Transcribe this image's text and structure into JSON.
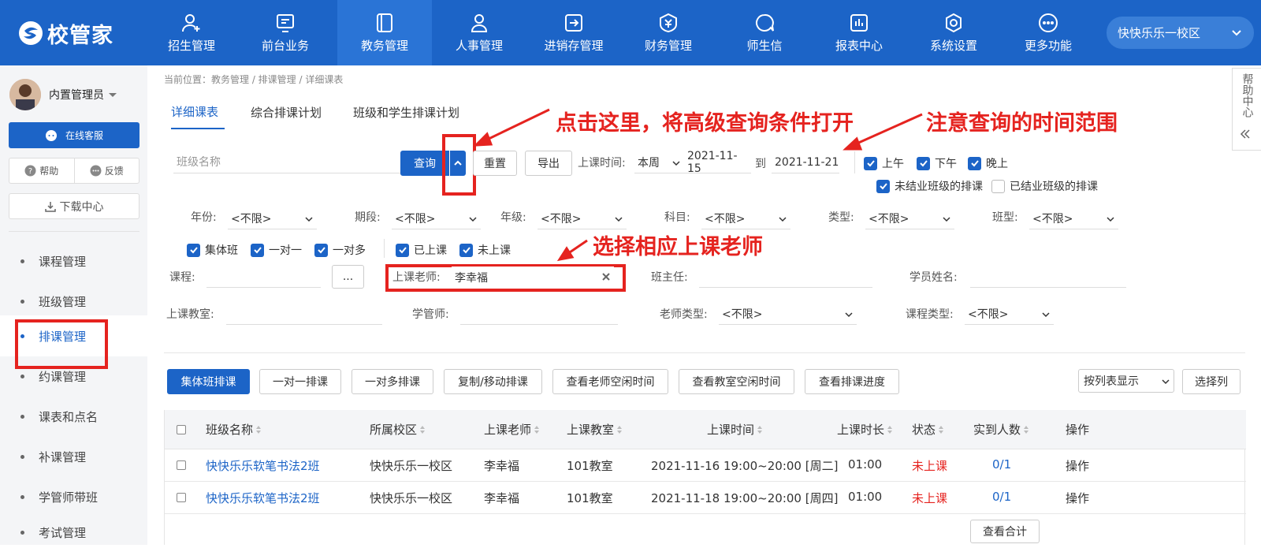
{
  "header": {
    "logo_text": "校管家",
    "nav": [
      {
        "label": "招生管理",
        "icon": "user-add-icon"
      },
      {
        "label": "前台业务",
        "icon": "monitor-icon"
      },
      {
        "label": "教务管理",
        "icon": "book-icon"
      },
      {
        "label": "人事管理",
        "icon": "person-icon"
      },
      {
        "label": "进销存管理",
        "icon": "export-box-icon"
      },
      {
        "label": "财务管理",
        "icon": "yen-shield-icon"
      },
      {
        "label": "师生信",
        "icon": "chat-bubble-icon"
      },
      {
        "label": "报表中心",
        "icon": "bar-chart-icon"
      },
      {
        "label": "系统设置",
        "icon": "settings-icon"
      },
      {
        "label": "更多功能",
        "icon": "more-icon"
      }
    ],
    "active_nav": "教务管理",
    "campus": "快快乐乐一校区"
  },
  "sidebar": {
    "user_name": "内置管理员",
    "service_button": "在线客服",
    "help": "帮助",
    "feedback": "反馈",
    "download": "下载中心",
    "menu": [
      "课程管理",
      "班级管理",
      "排课管理",
      "约课管理",
      "课表和点名",
      "补课管理",
      "学管师带班",
      "考试管理"
    ],
    "active_menu": "排课管理"
  },
  "breadcrumb": "当前位置：教务管理 / 排课管理 / 详细课表",
  "help_center": "帮助中心",
  "tabs": [
    "详细课表",
    "综合排课计划",
    "班级和学生排课计划"
  ],
  "filters": {
    "class_name_placeholder": "班级名称",
    "query": "查询",
    "reset": "重置",
    "export": "导出",
    "time_label": "上课时间:",
    "time_range": "本周",
    "date_from": "2021-11-15",
    "date_to_label": "到",
    "date_to": "2021-11-21",
    "periods": [
      {
        "label": "上午",
        "checked": true
      },
      {
        "label": "下午",
        "checked": true
      },
      {
        "label": "晚上",
        "checked": true
      }
    ],
    "unfinished": {
      "label": "未结业班级的排课",
      "checked": true
    },
    "finished": {
      "label": "已结业班级的排课",
      "checked": false
    },
    "selects": [
      {
        "label": "年份:",
        "value": "<不限>"
      },
      {
        "label": "期段:",
        "value": "<不限>"
      },
      {
        "label": "年级:",
        "value": "<不限>"
      },
      {
        "label": "科目:",
        "value": "<不限>"
      },
      {
        "label": "类型:",
        "value": "<不限>"
      },
      {
        "label": "班型:",
        "value": "<不限>"
      }
    ],
    "class_types": [
      {
        "label": "集体班",
        "checked": true
      },
      {
        "label": "一对一",
        "checked": true
      },
      {
        "label": "一对多",
        "checked": true
      }
    ],
    "states": [
      {
        "label": "已上课",
        "checked": true
      },
      {
        "label": "未上课",
        "checked": true
      }
    ],
    "course_label": "课程:",
    "course_btn": "...",
    "teacher_label": "上课老师:",
    "teacher_value": "李幸福",
    "head_teacher_label": "班主任:",
    "student_name_label": "学员姓名:",
    "classroom_label": "上课教室:",
    "manager_label": "学管师:",
    "teacher_type_label": "老师类型:",
    "teacher_type_value": "<不限>",
    "course_type_label": "课程类型:",
    "course_type_value": "<不限>"
  },
  "annotations": {
    "a1": "点击这里，将高级查询条件打开",
    "a2": "注意查询的时间范围",
    "a3": "选择相应上课老师"
  },
  "toolbar": {
    "buttons": [
      "集体班排课",
      "一对一排课",
      "一对多排课",
      "复制/移动排课",
      "查看老师空闲时间",
      "查看教室空闲时间",
      "查看排课进度"
    ],
    "view_mode": "按列表显示",
    "choose_columns": "选择列"
  },
  "table": {
    "headers": [
      "班级名称",
      "所属校区",
      "上课老师",
      "上课教室",
      "上课时间",
      "上课时长",
      "状态",
      "实到人数",
      "操作"
    ],
    "rows": [
      [
        "快快乐乐软笔书法2班",
        "快快乐乐一校区",
        "李幸福",
        "101教室",
        "2021-11-16 19:00~20:00 [周二]",
        "01:00",
        "未上课",
        "0/1",
        "操作"
      ],
      [
        "快快乐乐软笔书法2班",
        "快快乐乐一校区",
        "李幸福",
        "101教室",
        "2021-11-18 19:00~20:00 [周四]",
        "01:00",
        "未上课",
        "0/1",
        "操作"
      ]
    ],
    "sum_button": "查看合计"
  },
  "colors": {
    "primary": "#1c64c7",
    "annotation": "#e5231f"
  }
}
